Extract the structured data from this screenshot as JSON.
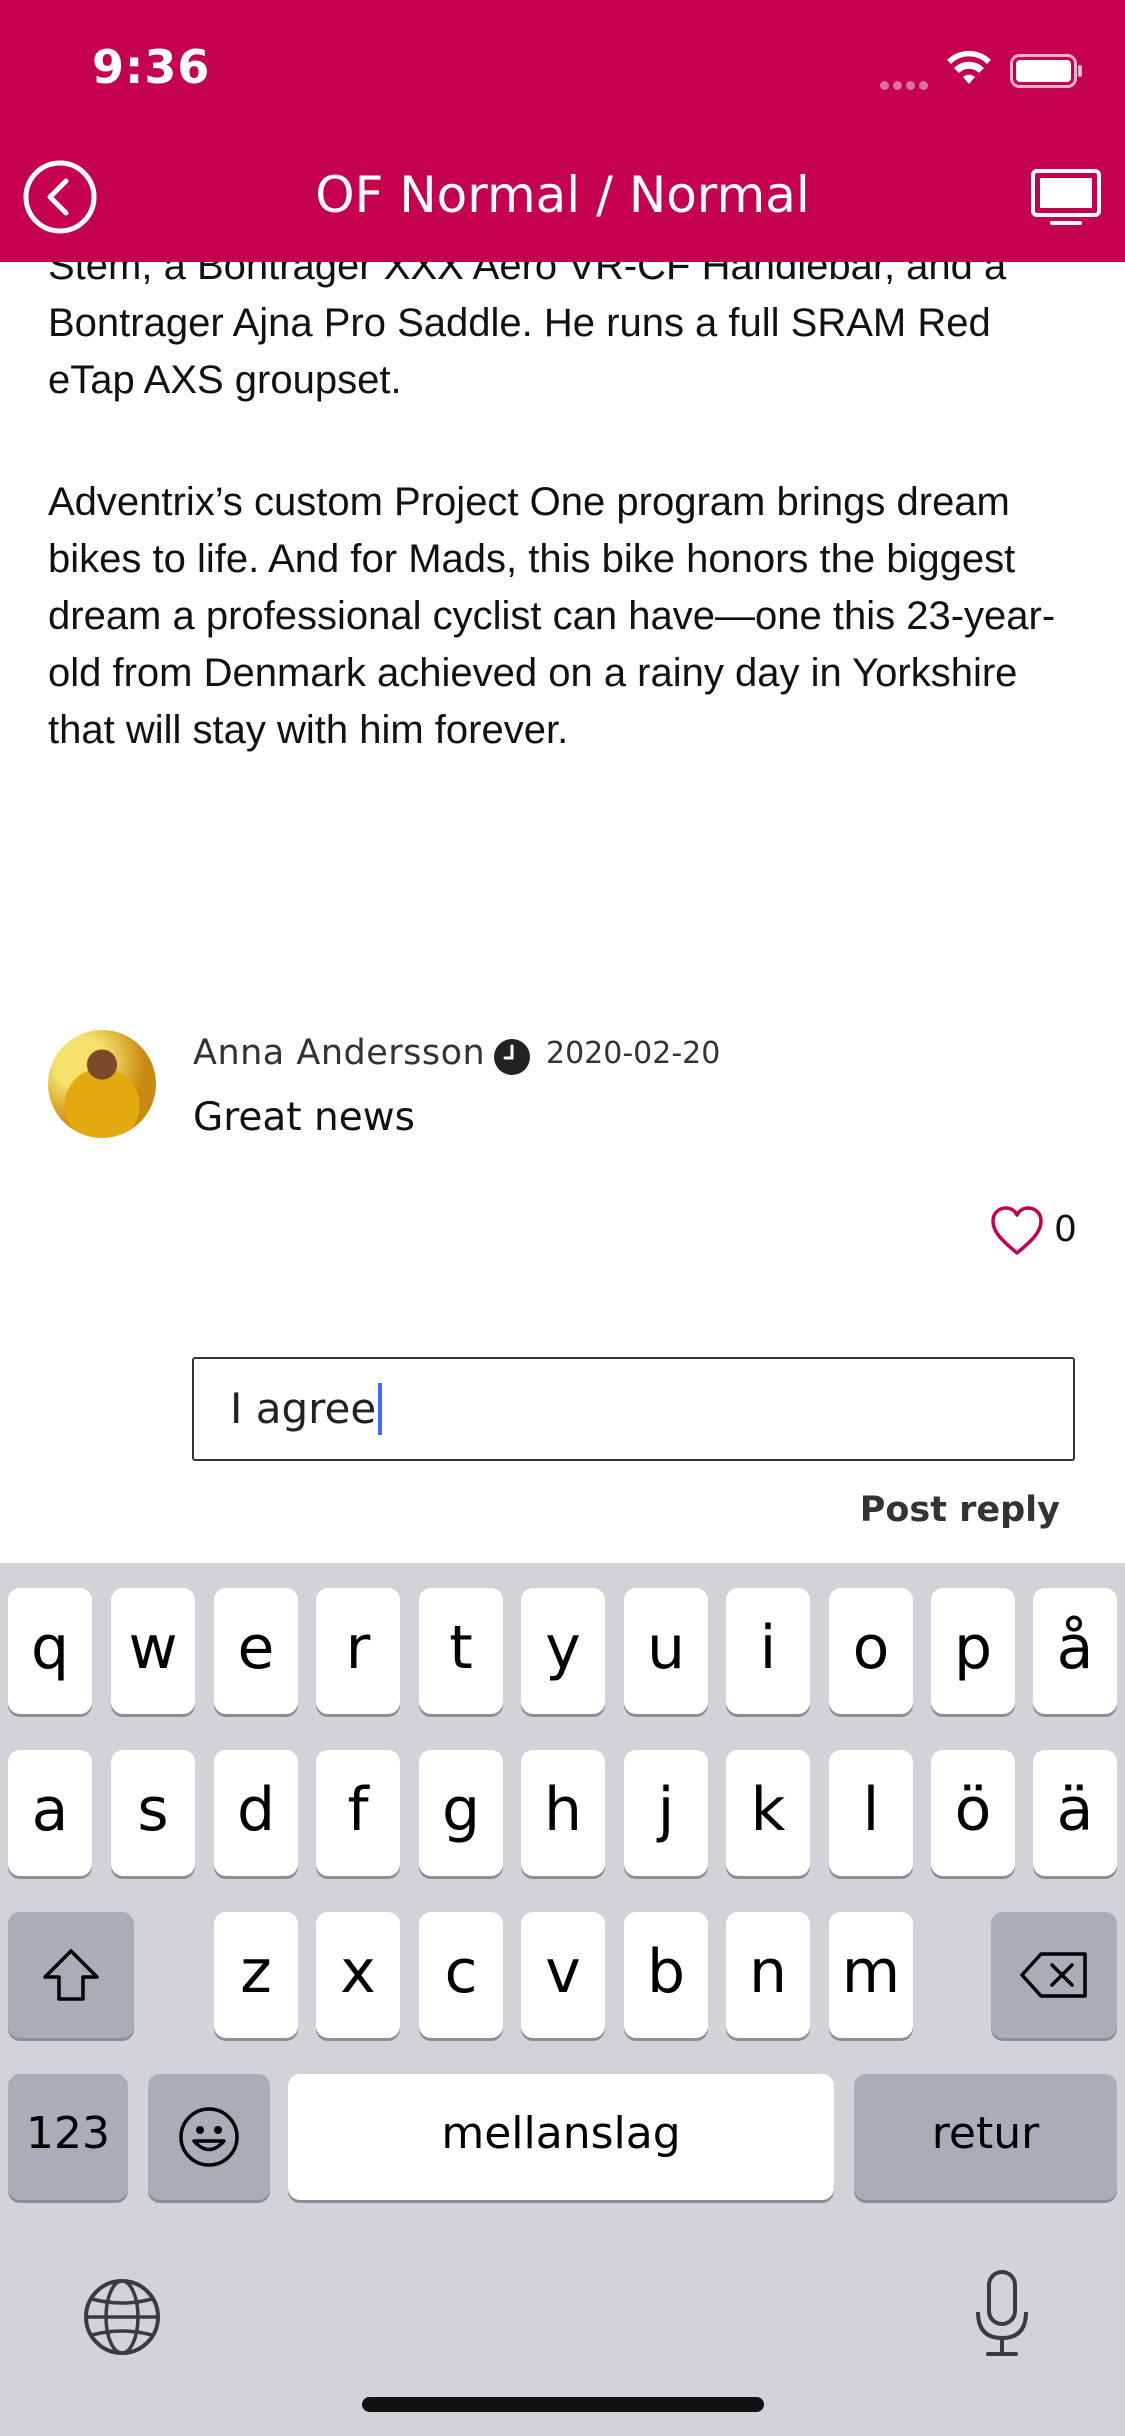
{
  "status_bar": {
    "time": "9:36"
  },
  "nav": {
    "title": "OF Normal / Normal"
  },
  "article": {
    "paragraph1": "Stem, a Bontrager XXX Aero VR-CF Handlebar, and a Bontrager Ajna Pro Saddle. He runs a full SRAM Red eTap AXS groupset.",
    "paragraph2": "Adventrix’s custom Project One program brings dream bikes to life. And for Mads, this bike honors the biggest dream a professional cyclist can have—one this 23-year-old from Denmark achieved on a rainy day in Yorkshire that will stay with him forever."
  },
  "comment": {
    "author": "Anna Andersson",
    "date": "2020-02-20",
    "text": "Great news",
    "likes": "0"
  },
  "reply": {
    "input_value": "I agree",
    "post_label": "Post reply"
  },
  "keyboard": {
    "row1": [
      "q",
      "w",
      "e",
      "r",
      "t",
      "y",
      "u",
      "i",
      "o",
      "p",
      "å"
    ],
    "row2": [
      "a",
      "s",
      "d",
      "f",
      "g",
      "h",
      "j",
      "k",
      "l",
      "ö",
      "ä"
    ],
    "row3": [
      "z",
      "x",
      "c",
      "v",
      "b",
      "n",
      "m"
    ],
    "numbers_label": "123",
    "space_label": "mellanslag",
    "return_label": "retur"
  },
  "colors": {
    "accent": "#c4004f",
    "keyboard_bg": "#d1d3d9",
    "cursor": "#3b6cf6"
  }
}
